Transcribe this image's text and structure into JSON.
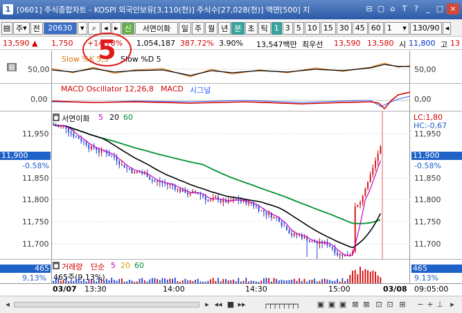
{
  "window": {
    "icon": "1",
    "title": "[0601] 주식종합차트 - KOSPI 외국인보유[3,110(천)] 주식수[27,028(천)] 액면[500] 지",
    "buttons": [
      "restore-icon",
      "maximize-icon",
      "lock-icon",
      "font-icon",
      "help-icon",
      "minimize-icon",
      "maximize-icon",
      "close-icon"
    ],
    "button_glyphs": [
      "⊟",
      "▢",
      "⌂",
      "T",
      "?",
      "_",
      "□",
      "×"
    ]
  },
  "toolbar": {
    "stock_type": "주",
    "market": "전",
    "code": "20630",
    "name_badge": "신",
    "stock_name": "서연이화",
    "periods": [
      "일",
      "주",
      "월",
      "년",
      "분",
      "초",
      "틱"
    ],
    "selected_period": "분",
    "intervals": [
      "1",
      "3",
      "5",
      "10",
      "15",
      "30",
      "45",
      "60"
    ],
    "selected_interval": "1",
    "unit_value": "1",
    "view_count": "130/90"
  },
  "quote": {
    "price": "13,590",
    "change": "1,750",
    "change_rate": "+14.78%",
    "volume": "1,054,187",
    "volume_rate": "387.72%",
    "turnover": "3.90%",
    "amount": "13,547백만",
    "priority_label": "최우선",
    "ask": "13,590",
    "bid": "13,580",
    "open_label": "시",
    "open": "11,800",
    "high_label": "고",
    "high": "13"
  },
  "panels": {
    "stoch": {
      "title": "Slow %K 5,3",
      "title2": "Slow %D 5",
      "yaxis": "50,00"
    },
    "macd": {
      "title": "MACD Oscillator 12,26,8",
      "title2": "MACD",
      "title3": "시그널",
      "yaxis": "0,00"
    },
    "price": {
      "legend_name": "서연이화",
      "ma": [
        "5",
        "20",
        "60"
      ],
      "yticks": [
        "11,950",
        "11,900",
        "11,850",
        "11,800",
        "11,750",
        "11,700"
      ],
      "current": "11,900",
      "current_rate": "-0.58%",
      "lc": "LC:1,80",
      "hc": "HC:-0,67"
    },
    "volume": {
      "title": "거래량",
      "type": "단순",
      "ma": [
        "5",
        "20",
        "60"
      ],
      "current": "465",
      "current_rate": "9.13%",
      "summary": "465주(9.13%)",
      "left_rate": "9,13%"
    }
  },
  "time_axis": {
    "labels": [
      "03/07",
      "13:30",
      "14:00",
      "14:30",
      "15:00",
      "03/08"
    ],
    "right_time": "09:05:00"
  },
  "annotation": {
    "number": "5"
  },
  "colors": {
    "up": "#d40000",
    "down": "#1f3fd0",
    "ma5": "#c000c0",
    "ma20": "#000000",
    "ma60": "#009030",
    "stoch_k": "#000000",
    "stoch_d": "#e07000",
    "macd_line": "#d40000",
    "signal": "#3060ff"
  },
  "chart_data": {
    "type": "candlestick",
    "title": "서연이화",
    "xlabel": "",
    "ylabel": "",
    "ylim": [
      11685,
      11980
    ],
    "x_labels": [
      "03/07",
      "13:30",
      "14:00",
      "14:30",
      "15:00",
      "03/08"
    ],
    "series": [
      {
        "name": "5",
        "type": "line"
      },
      {
        "name": "20",
        "type": "line"
      },
      {
        "name": "60",
        "type": "line"
      }
    ]
  }
}
